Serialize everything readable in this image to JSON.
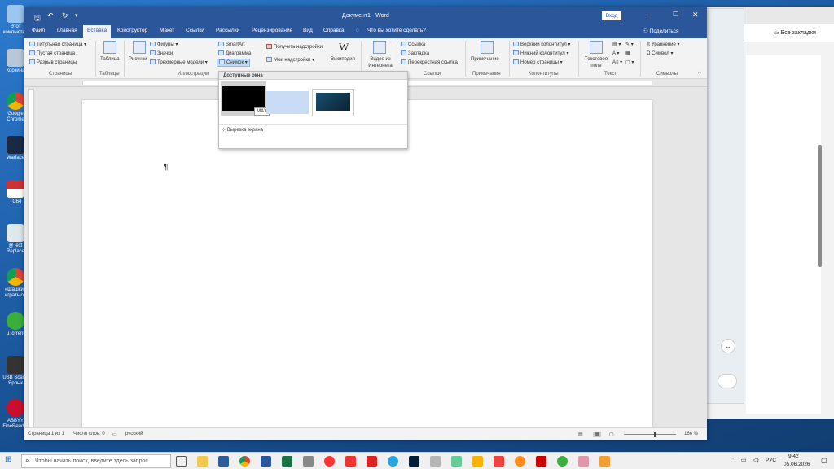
{
  "desktop": {
    "icons": [
      "Этот компьютер",
      "Корзина",
      "Google Chrome",
      "Warface",
      "TC64",
      "@Text Replace",
      "«Шашки» играть он",
      "µTorrent",
      "USB Scan - Ярлык",
      "ABBYY FineReader"
    ]
  },
  "bg_browser": {
    "bookmarks_label": "Все закладки"
  },
  "word": {
    "title": "Документ1 - Word",
    "signin": "Вход",
    "qat": {
      "save": "save-icon",
      "undo": "undo-icon",
      "redo": "redo-icon"
    },
    "tabs": [
      "Файл",
      "Главная",
      "Вставка",
      "Конструктор",
      "Макет",
      "Ссылки",
      "Рассылки",
      "Рецензирование",
      "Вид",
      "Справка"
    ],
    "active_tab": "Вставка",
    "tell_me": "Что вы хотите сделать?",
    "share": "Поделиться",
    "ribbon": {
      "pages": {
        "items": [
          "Титульная страница",
          "Пустая страница",
          "Разрыв страницы"
        ],
        "label": "Страницы"
      },
      "tables": {
        "table": "Таблица",
        "label": "Таблицы"
      },
      "illustrations": {
        "pictures": "Рисунки",
        "shapes": "Фигуры",
        "icons": "Значки",
        "models": "Трехмерные модели",
        "smartart": "SmartArt",
        "chart": "Диаграмма",
        "screenshot": "Снимок",
        "label": "Иллюстрации"
      },
      "addins": {
        "get": "Получить надстройки",
        "my": "Мои надстройки",
        "wiki": "Википедия"
      },
      "media": {
        "online_video": "Видео из Интернета"
      },
      "links": {
        "link": "Ссылка",
        "bookmark": "Закладка",
        "cross_ref": "Перекрестная ссылка",
        "label": "Ссылки"
      },
      "comments": {
        "comment": "Примечание",
        "label": "Примечания"
      },
      "header_footer": {
        "header": "Верхний колонтитул",
        "footer": "Нижний колонтитул",
        "page_number": "Номер страницы",
        "label": "Колонтитулы"
      },
      "text": {
        "textbox": "Текстовое поле",
        "label": "Текст"
      },
      "symbols": {
        "equation": "Уравнение",
        "symbol": "Символ",
        "label": "Символы"
      }
    },
    "screenshot_dropdown": {
      "header": "Доступные окна",
      "tooltip": "MAX",
      "clipping": "Вырезка экрана"
    },
    "document": {
      "pilcrow": "¶"
    },
    "status": {
      "page": "Страница 1 из 1",
      "words": "Число слов: 0",
      "lang": "русский",
      "zoom": "166 %"
    }
  },
  "taskbar": {
    "search_placeholder": "Чтобы начать поиск, введите здесь запрос",
    "tray_lang": "РУС",
    "time": "9:42",
    "date": "05.06.2026"
  }
}
